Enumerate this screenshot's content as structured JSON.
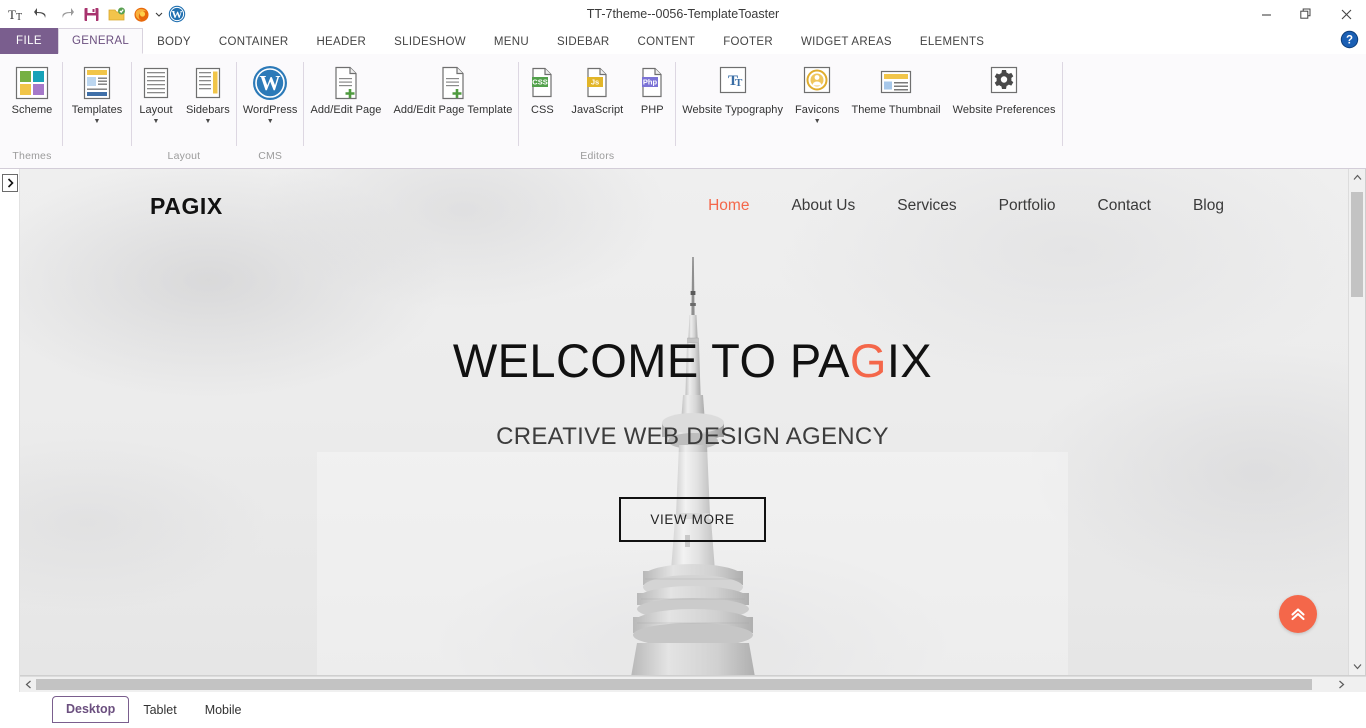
{
  "window": {
    "title": "TT-7theme--0056-TemplateToaster",
    "minimize_label": "Minimize",
    "restore_label": "Restore",
    "close_label": "Close",
    "help_label": "Help"
  },
  "quick_access": [
    {
      "name": "font-size-icon",
      "label": "Tt"
    },
    {
      "name": "undo-icon",
      "label": "Undo"
    },
    {
      "name": "redo-icon",
      "label": "Redo"
    },
    {
      "name": "save-icon",
      "label": "Save"
    },
    {
      "name": "export-icon",
      "label": "Export"
    },
    {
      "name": "firefox-preview-icon",
      "label": "Preview in Firefox"
    },
    {
      "name": "browser-dropdown-icon",
      "label": "Browser options"
    },
    {
      "name": "wordpress-icon",
      "label": "WordPress"
    }
  ],
  "ribbon": {
    "file_tab": "FILE",
    "tabs": [
      "GENERAL",
      "BODY",
      "CONTAINER",
      "HEADER",
      "SLIDESHOW",
      "MENU",
      "SIDEBAR",
      "CONTENT",
      "FOOTER",
      "WIDGET AREAS",
      "ELEMENTS"
    ],
    "active_tab": "GENERAL",
    "groups": [
      {
        "label": "Themes",
        "buttons": [
          {
            "name": "scheme-button",
            "label": "Scheme",
            "icon": "color-scheme-icon",
            "caret": false
          }
        ]
      },
      {
        "label": "",
        "buttons": [
          {
            "name": "templates-button",
            "label": "Templates",
            "icon": "template-page-icon",
            "caret": true
          }
        ]
      },
      {
        "label": "Layout",
        "buttons": [
          {
            "name": "layout-button",
            "label": "Layout",
            "icon": "layout-icon",
            "caret": true
          },
          {
            "name": "sidebars-button",
            "label": "Sidebars",
            "icon": "sidebars-icon",
            "caret": true
          }
        ]
      },
      {
        "label": "CMS",
        "buttons": [
          {
            "name": "wordpress-button",
            "label": "WordPress",
            "icon": "wordpress-icon",
            "caret": true
          }
        ]
      },
      {
        "label": "",
        "buttons": [
          {
            "name": "add-edit-page-button",
            "label": "Add/Edit Page",
            "icon": "page-add-icon",
            "caret": false
          },
          {
            "name": "add-edit-page-template-button",
            "label": "Add/Edit Page Template",
            "icon": "page-template-add-icon",
            "caret": false
          }
        ]
      },
      {
        "label": "Editors",
        "buttons": [
          {
            "name": "css-editor-button",
            "label": "CSS",
            "icon": "css-file-icon",
            "caret": false
          },
          {
            "name": "javascript-editor-button",
            "label": "JavaScript",
            "icon": "js-file-icon",
            "caret": false
          },
          {
            "name": "php-editor-button",
            "label": "PHP",
            "icon": "php-file-icon",
            "caret": false
          }
        ]
      },
      {
        "label": "",
        "buttons": [
          {
            "name": "website-typography-button",
            "label": "Website Typography",
            "icon": "typography-icon",
            "caret": false
          },
          {
            "name": "favicons-button",
            "label": "Favicons",
            "icon": "favicon-icon",
            "caret": true
          },
          {
            "name": "theme-thumbnail-button",
            "label": "Theme Thumbnail",
            "icon": "thumbnail-icon",
            "caret": false
          },
          {
            "name": "website-preferences-button",
            "label": "Website Preferences",
            "icon": "gear-icon",
            "caret": false
          }
        ]
      }
    ]
  },
  "preview": {
    "logo": "PAGIX",
    "nav": [
      {
        "label": "Home",
        "active": true
      },
      {
        "label": "About Us",
        "active": false
      },
      {
        "label": "Services",
        "active": false
      },
      {
        "label": "Portfolio",
        "active": false
      },
      {
        "label": "Contact",
        "active": false
      },
      {
        "label": "Blog",
        "active": false
      }
    ],
    "hero": {
      "title_prefix": "WELCOME TO PA",
      "title_highlight": "G",
      "title_suffix": "IX",
      "subtitle": "CREATIVE WEB DESIGN AGENCY",
      "cta": "VIEW MORE"
    },
    "scroll_top_label": "Back to top"
  },
  "device_tabs": [
    {
      "label": "Desktop",
      "active": true
    },
    {
      "label": "Tablet",
      "active": false
    },
    {
      "label": "Mobile",
      "active": false
    }
  ],
  "colors": {
    "accent": "#7a5e8e",
    "brand_coral": "#f4674a",
    "ribbon_bg": "#fbfafc",
    "group_label": "#9b9b9b"
  }
}
